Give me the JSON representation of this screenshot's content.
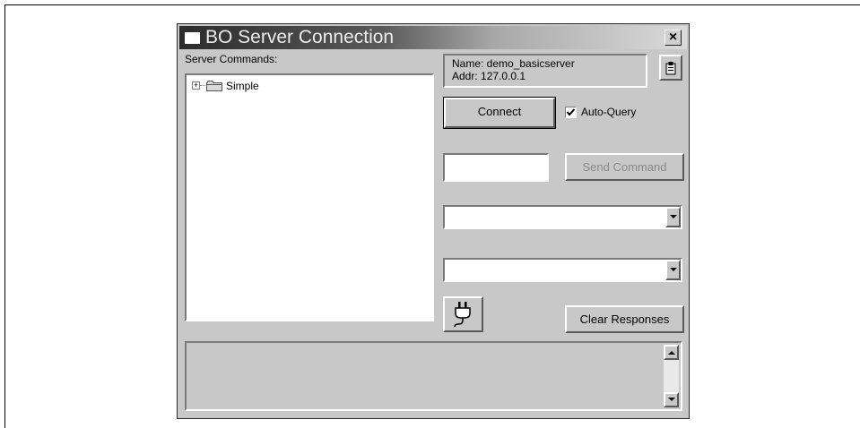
{
  "window": {
    "title": "BO Server Connection",
    "close_label": "×"
  },
  "commands": {
    "label": "Server Commands:",
    "tree": [
      {
        "label": "Simple",
        "expander": "+"
      }
    ]
  },
  "server": {
    "name_line": "Name: demo_basicserver",
    "addr_line": "Addr: 127.0.0.1"
  },
  "connect": {
    "label": "Connect"
  },
  "auto_query": {
    "label": "Auto-Query",
    "checked": true
  },
  "command_input": {
    "value": ""
  },
  "send_command": {
    "label": "Send Command",
    "enabled": false
  },
  "dropdown1": {
    "value": ""
  },
  "dropdown2": {
    "value": ""
  },
  "clear_responses": {
    "label": "Clear Responses"
  },
  "responses": {
    "text": ""
  },
  "icons": {
    "title": "window-icon",
    "clipboard": "clipboard-icon",
    "plug": "plug-icon"
  }
}
